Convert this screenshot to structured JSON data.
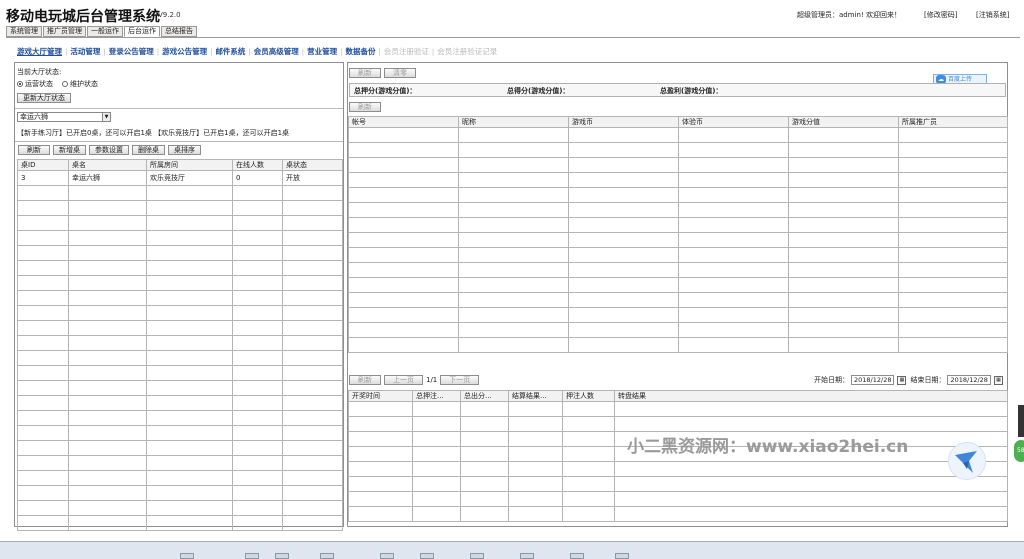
{
  "header": {
    "title": "移动电玩城后台管理系统",
    "version": "V9.2.0",
    "welcome": "超级管理员：admin! 欢迎回来！",
    "change_password": "[修改密码]",
    "logout": "[注销系统]"
  },
  "main_tabs": [
    "系统管理",
    "推广员管理",
    "一般运作",
    "后台运作",
    "总结报告"
  ],
  "sub_nav": {
    "items": [
      "游戏大厅管理",
      "活动管理",
      "登录公告管理",
      "游戏公告管理",
      "邮件系统",
      "会员高级管理",
      "营业管理",
      "数据备份"
    ],
    "disabled_items": [
      "会员注册验证",
      "会员注册验证记录"
    ]
  },
  "left": {
    "hall_status_label": "当前大厅状态:",
    "radio_operating": "运营状态",
    "radio_maintenance": "维护状态",
    "update_button": "更新大厅状态",
    "game_select": "幸运六狮",
    "info_line": "【新手练习厅】已开启0桌，还可以开启1桌   【欢乐竞技厅】已开启1桌，还可以开启1桌",
    "buttons": [
      "刷新",
      "新增桌",
      "参数设置",
      "删除桌",
      "桌排序"
    ],
    "table": {
      "headers": [
        "桌ID",
        "桌名",
        "所属房间",
        "在线人数",
        "桌状态"
      ],
      "rows": [
        [
          "3",
          "幸运六狮",
          "欢乐竞技厅",
          "0",
          "开放"
        ]
      ]
    }
  },
  "right": {
    "top_buttons": [
      "刷新",
      "清零"
    ],
    "upload_badge": "百度上传",
    "totals": {
      "bet": "总押分(游戏分值)：",
      "win": "总得分(游戏分值)：",
      "profit": "总盈利(游戏分值)："
    },
    "refresh_button": "刷新",
    "players_table": {
      "headers": [
        "帐号",
        "昵称",
        "游戏币",
        "体验币",
        "游戏分值",
        "所属推广员"
      ]
    },
    "pager": {
      "refresh": "刷新",
      "prev": "上一页",
      "page_info": "1/1",
      "next": "下一页",
      "start_label": "开始日期：",
      "start_date": "2018/12/28",
      "end_label": "结束日期：",
      "end_date": "2018/12/28"
    },
    "results_table": {
      "headers": [
        "开奖时间",
        "总押注...",
        "总出分...",
        "结算结果...",
        "押注人数",
        "转盘结果"
      ]
    }
  },
  "watermark": "小二黑资源网：www.xiao2hei.cn",
  "side_badge": "58"
}
